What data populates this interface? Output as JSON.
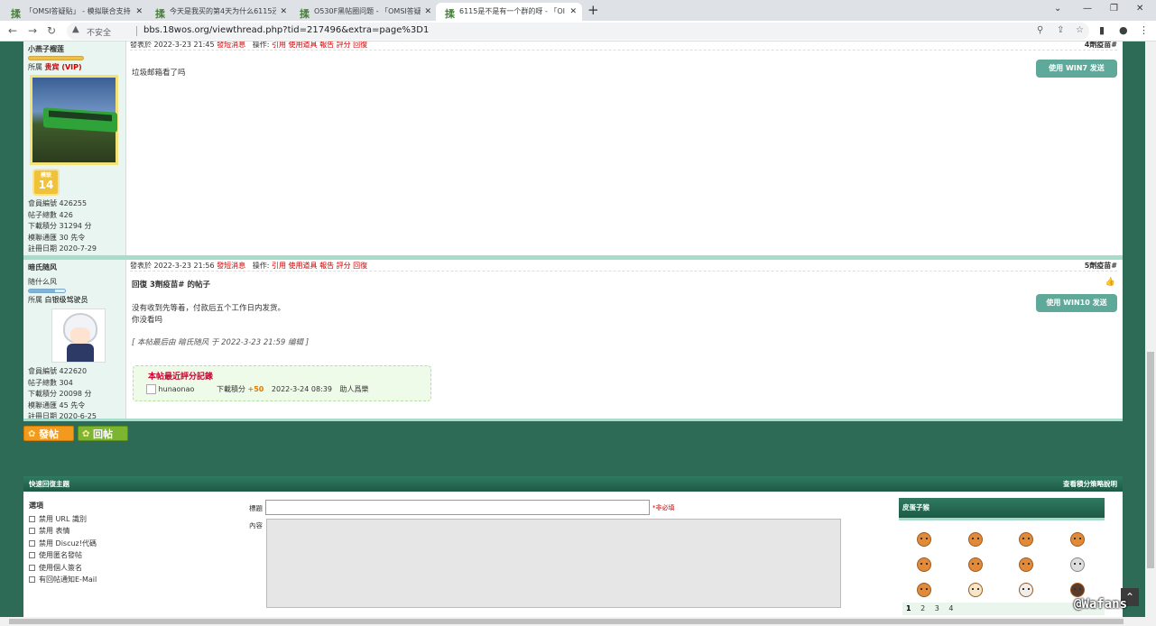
{
  "browser": {
    "tabs": [
      {
        "title": "「OMSI答疑贴」 - 模拟联合支持"
      },
      {
        "title": "今天是我买的第4天为什么6115还"
      },
      {
        "title": "O530F黑帖圈问题 - 「OMSI答疑"
      },
      {
        "title": "6115是不是有一个群的呀 - 「OI"
      }
    ],
    "active_tab_index": 3,
    "new_tab": "+",
    "insecure_label": "不安全",
    "url": "bbs.18wos.org/viewthread.php?tid=217496&extra=page%3D1"
  },
  "posts": [
    {
      "author": "小燕子榴莲",
      "group_label": "所属",
      "group": "贵宾 (VIP)",
      "level": "14",
      "level_label": "模联",
      "stats": [
        {
          "k": "會員編號",
          "v": "426255"
        },
        {
          "k": "帖子總數",
          "v": "426"
        },
        {
          "k": "下載積分",
          "v": "31294 分"
        },
        {
          "k": "模聯通匯",
          "v": "30 先令"
        },
        {
          "k": "註冊日期",
          "v": "2020-7-29"
        }
      ],
      "meta_prefix": "發表於 2022-3-23 21:45",
      "meta_pm": "發短消息",
      "meta_ops_label": "操作:",
      "meta_ops": "引用 使用道具 報告 評分 回復",
      "floor": "4劑疫苗#",
      "body": "垃圾邮箱看了吗",
      "send_button": "使用 WIN7 发送"
    },
    {
      "author": "暗氏随风",
      "signature": "随什么风",
      "group_label": "所属",
      "group": "白银级驾驶员",
      "stats": [
        {
          "k": "會員編號",
          "v": "422620"
        },
        {
          "k": "帖子總數",
          "v": "304"
        },
        {
          "k": "下載積分",
          "v": "20098 分"
        },
        {
          "k": "模聯通匯",
          "v": "45 先令"
        },
        {
          "k": "註冊日期",
          "v": "2020-6-25"
        }
      ],
      "meta_prefix": "發表於 2022-3-23 21:56",
      "meta_pm": "發短消息",
      "meta_ops_label": "操作:",
      "meta_ops": "引用 使用道具 報告 評分 回復",
      "floor": "5劑疫苗#",
      "reply_title": "回復 3劑疫苗# 的帖子",
      "body_line1": "没有收到先等着，付款后五个工作日内发货。",
      "body_line2": "你没看吗",
      "edit_note": "[ 本帖最后由 暗氏随风 于 2022-3-23 21:59 编辑 ]",
      "rating_title": "本帖最近評分記錄",
      "rating_user": "hunaonao",
      "rating_field": "下載積分",
      "rating_value": "+50",
      "rating_time": "2022-3-24 08:39",
      "rating_reason": "助人爲樂",
      "send_button": "使用 WIN10 发送"
    }
  ],
  "actions": {
    "new_post": "發帖",
    "reply": "回帖"
  },
  "quick_reply": {
    "title": "快速回復主題",
    "right_link": "查看積分策略說明",
    "options_title": "選項",
    "options": [
      "禁用 URL 識別",
      "禁用 表情",
      "禁用 Discuz!代碼",
      "使用匿名發帖",
      "使用個人簽名",
      "有回帖通知E-Mail"
    ],
    "subject_label": "標題",
    "required_note": "*非必填",
    "content_label": "內容",
    "smilies_title": "皮蛋子猴",
    "pages": [
      "1",
      "2",
      "3",
      "4"
    ]
  },
  "watermark": "@Wafans",
  "colors": {
    "accent": "#2d6b57",
    "send_button": "#5fa99a",
    "new_post": "#f39a1e",
    "reply": "#7cb52f"
  }
}
